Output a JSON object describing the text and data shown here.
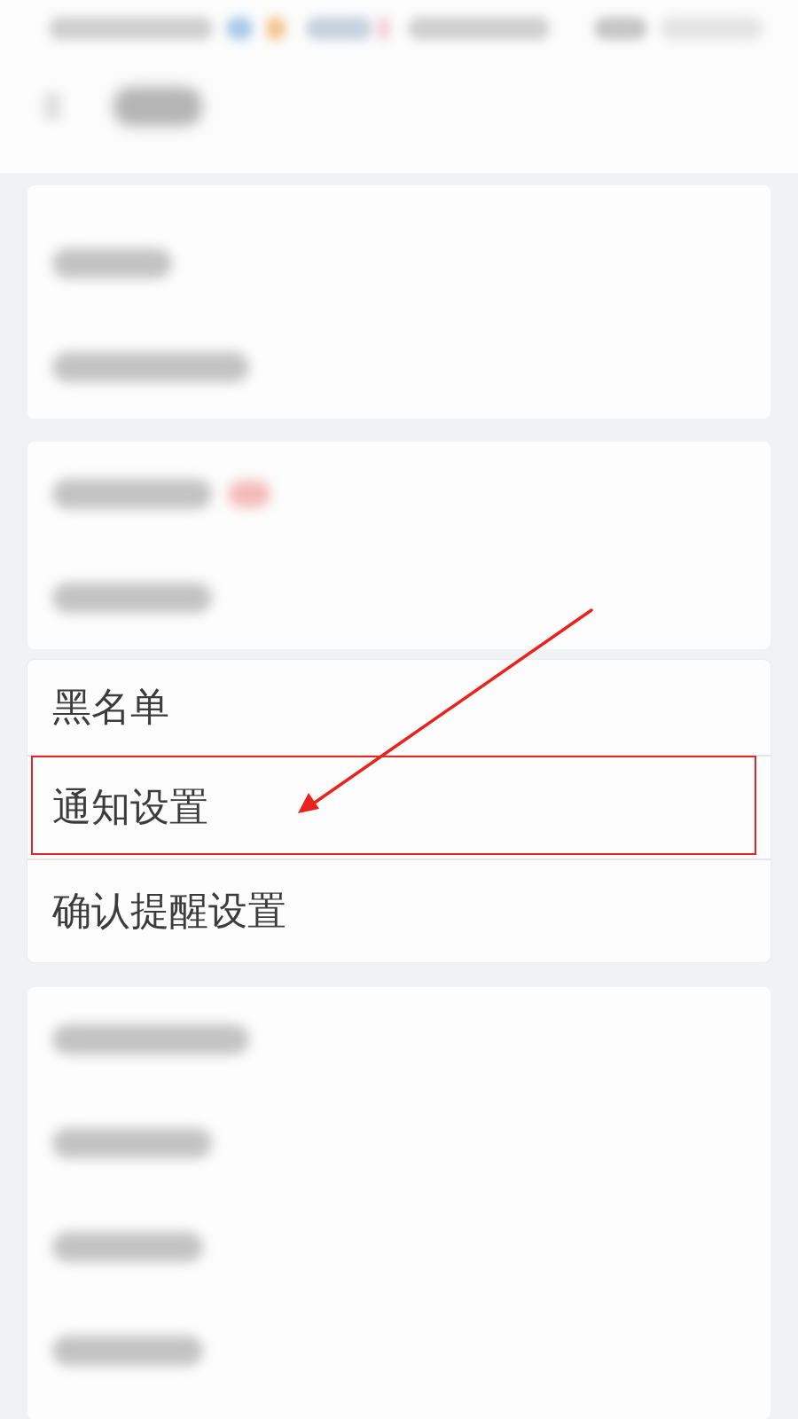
{
  "settings_list": [
    {
      "label": "黑名单",
      "highlighted": false
    },
    {
      "label": "通知设置",
      "highlighted": true
    },
    {
      "label": "确认提醒设置",
      "highlighted": false
    }
  ]
}
